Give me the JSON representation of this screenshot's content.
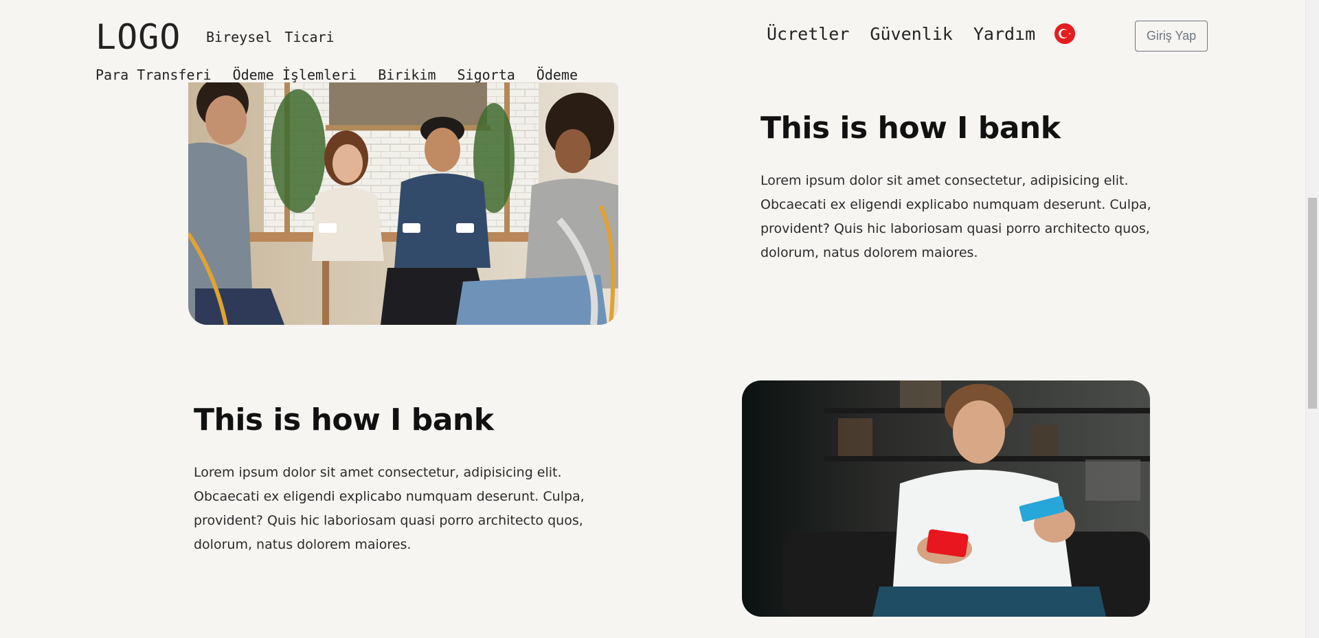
{
  "header": {
    "logo": "LOGO",
    "segments": [
      "Bireysel",
      "Ticari"
    ],
    "right_links": [
      "Ücretler",
      "Güvenlik",
      "Yardım"
    ],
    "language_flag": "turkey-flag-icon",
    "login_label": "Giriş Yap"
  },
  "main_nav": [
    "Para Transferi",
    "Ödeme İşlemleri",
    "Birikim",
    "Sigorta",
    "Ödeme"
  ],
  "sections": [
    {
      "heading": "This is how I bank",
      "text": "Lorem ipsum dolor sit amet consectetur, adipisicing elit. Obcaecati ex eligendi explicabo numquam deserunt. Culpa, provident? Quis hic laboriosam quasi porro architecto quos, dolorum, natus dolorem maiores.",
      "image": "friends-cafe-photo"
    },
    {
      "heading": "This is how I bank",
      "text": "Lorem ipsum dolor sit amet consectetur, adipisicing elit. Obcaecati ex eligendi explicabo numquam deserunt. Culpa, provident? Quis hic laboriosam quasi porro architecto quos, dolorum, natus dolorem maiores.",
      "image": "man-phone-card-photo"
    }
  ],
  "colors": {
    "background": "#f7f5f2",
    "text": "#111111",
    "button_border": "#6c757d",
    "flag_red": "#e41e20"
  }
}
